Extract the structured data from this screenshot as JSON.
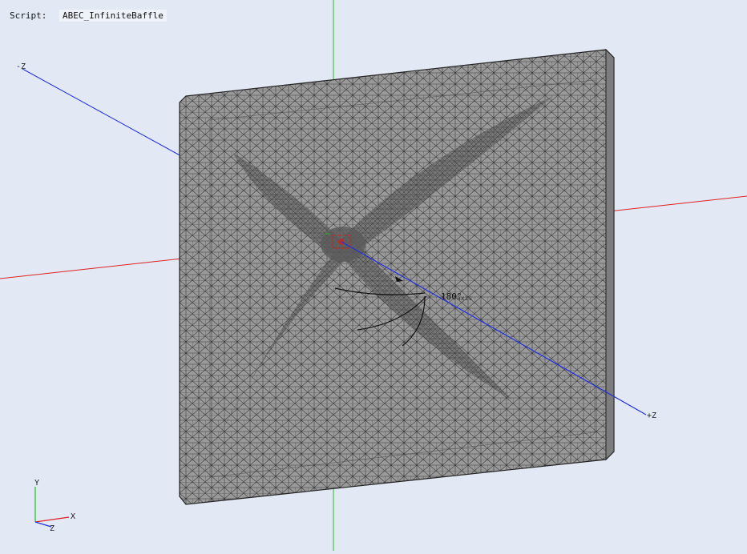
{
  "script": {
    "label": "Script:",
    "name": "ABEC_InfiniteBaffle"
  },
  "axes": {
    "neg_z_label": "-Z",
    "pos_z_label": "+Z",
    "angle_label": "180°",
    "angle_suffix": "axis"
  },
  "triad": {
    "y": "Y",
    "x": "X",
    "z": "Z"
  },
  "colors": {
    "background": "#e2e9f4",
    "mesh_fill": "#9a9a9a",
    "mesh_line": "#333333",
    "x_axis": "#e02020",
    "y_axis": "#20c020",
    "z_axis": "#2030e0",
    "source_marker": "#d02020"
  }
}
